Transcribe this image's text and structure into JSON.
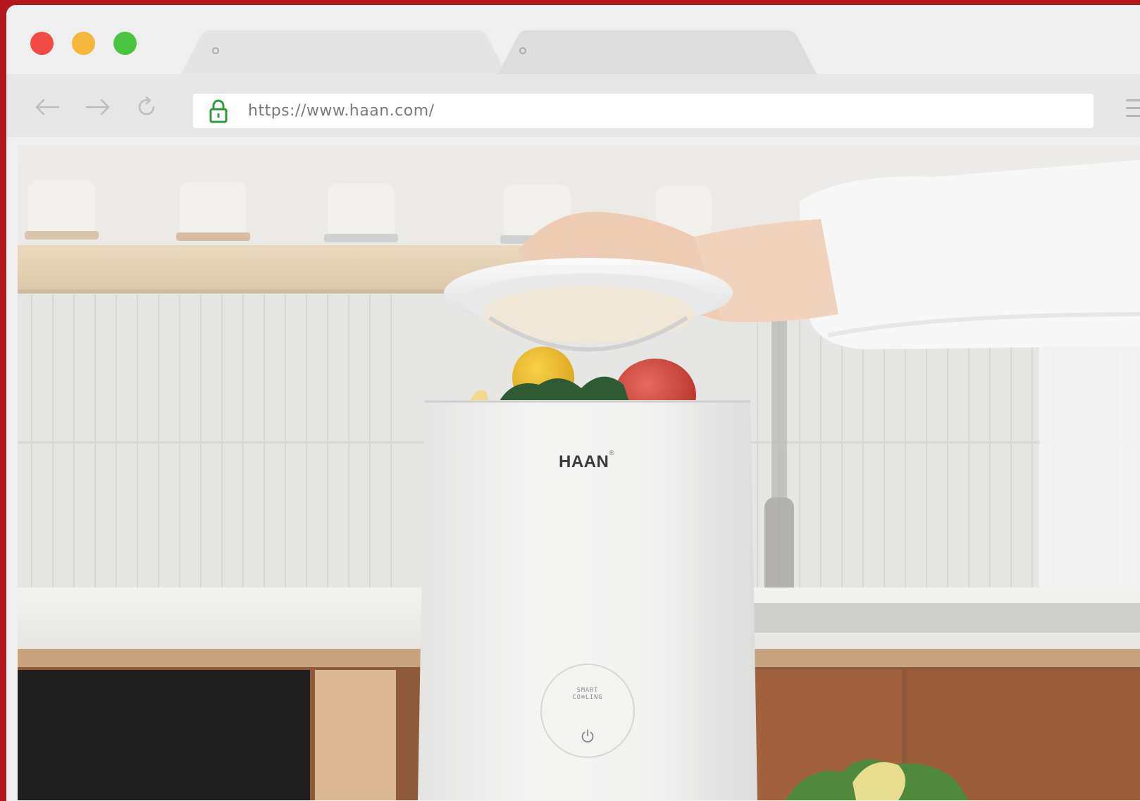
{
  "browser": {
    "window_controls": [
      "close-icon",
      "minimize-icon",
      "maximize-icon"
    ],
    "tabs": [
      {
        "label": "",
        "active": true
      },
      {
        "label": "",
        "active": false
      }
    ],
    "nav": [
      "back-arrow-icon",
      "forward-arrow-icon",
      "reload-icon"
    ],
    "address_bar": {
      "url": "https://www.haan.com/",
      "secure": true
    },
    "menu_icon": "hamburger-menu-icon"
  },
  "page": {
    "product": {
      "brand": "HAAN",
      "brand_mark": "®",
      "button_label_line1": "SMART",
      "button_label_line2": "CO❄LING",
      "power_icon": "power-icon"
    }
  },
  "colors": {
    "frame": "#b3191c",
    "chrome": "#efefef",
    "toolbar": "#e7e7e7",
    "lock": "#2e9a3c"
  }
}
